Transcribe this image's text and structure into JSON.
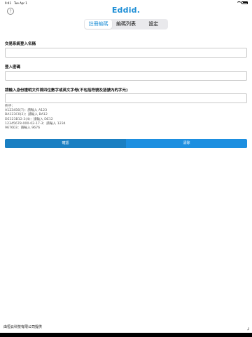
{
  "status_bar": {
    "time": "9:41",
    "date": "Tue Apr 1"
  },
  "header": {
    "logo": "Eddid.",
    "help_glyph": "?"
  },
  "tabs": [
    {
      "label": "註冊編碼",
      "active": true
    },
    {
      "label": "編碼列表",
      "active": false
    },
    {
      "label": "設定",
      "active": false
    }
  ],
  "form": {
    "username_label": "交易系統登入名稱",
    "username_value": "",
    "password_label": "登入密碼",
    "password_value": "",
    "id_label": "請輸入身份證明文件首四位數字或英文字母(不包括符號及括號內的字元)",
    "id_value": ""
  },
  "examples": {
    "title": "例子：",
    "lines": [
      "A123456(7)：請輸入 A123",
      "BA123C0(2)：請輸入 BA12",
      "DE123B12-3(4)：請輸入 DE12",
      "12345678-000-02-17-3：請輸入 1234",
      "967603：請輸入 9676"
    ]
  },
  "buttons": {
    "confirm": "確認",
    "clear": "清除"
  },
  "footer": {
    "text": "由恒云科技有限公司提供"
  },
  "colors": {
    "accent": "#1f8fd6",
    "confirm_bg": "#1a7fc2",
    "clear_bg": "#1d8fe0"
  }
}
